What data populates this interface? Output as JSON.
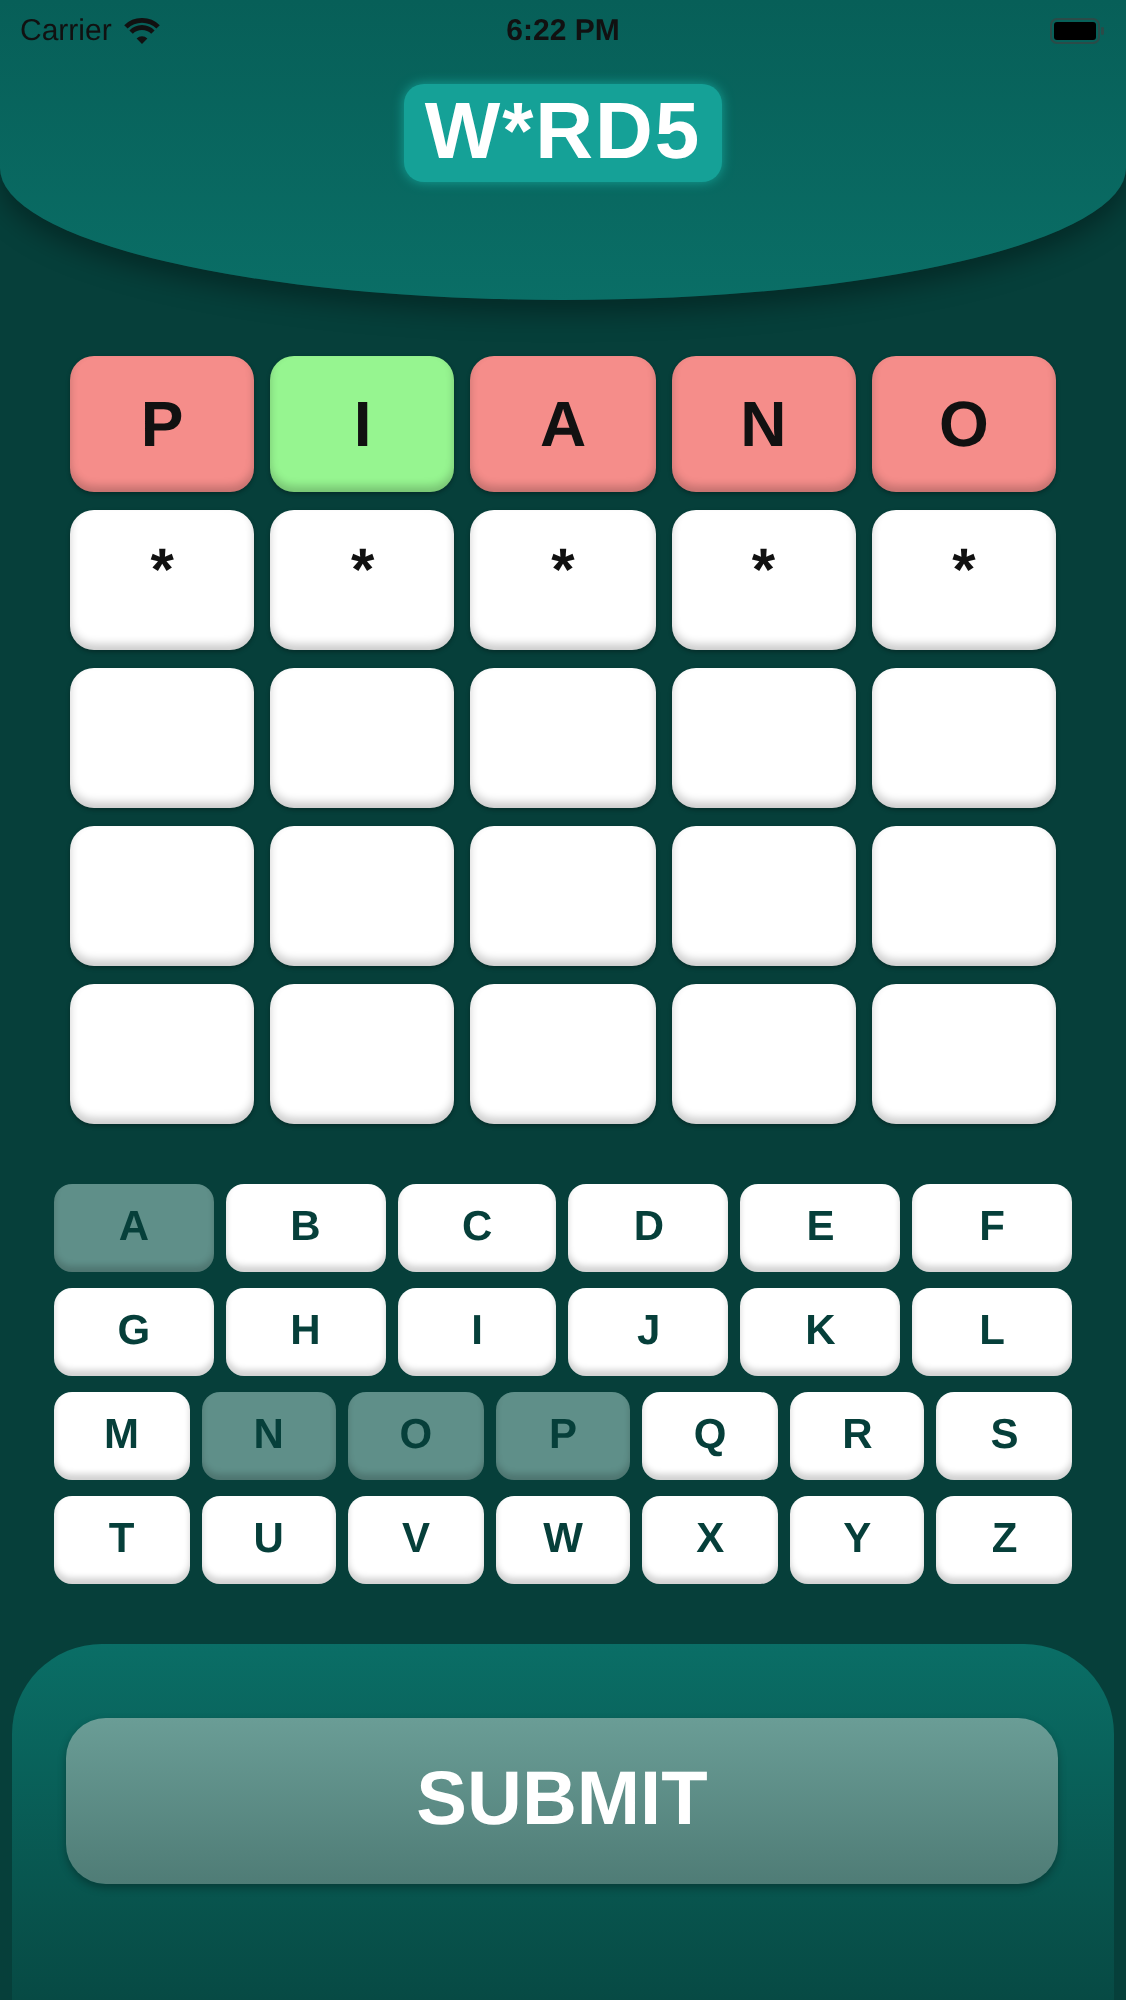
{
  "status_bar": {
    "carrier": "Carrier",
    "time": "6:22 PM"
  },
  "logo": {
    "text": "W*RD5"
  },
  "board": [
    {
      "cells": [
        {
          "kind": "absent",
          "letter": "P"
        },
        {
          "kind": "correct",
          "letter": "I"
        },
        {
          "kind": "absent",
          "letter": "A"
        },
        {
          "kind": "absent",
          "letter": "N"
        },
        {
          "kind": "absent",
          "letter": "O"
        }
      ]
    },
    {
      "cells": [
        {
          "kind": "open",
          "letter": "*"
        },
        {
          "kind": "open",
          "letter": "*"
        },
        {
          "kind": "open",
          "letter": "*"
        },
        {
          "kind": "open",
          "letter": "*"
        },
        {
          "kind": "open",
          "letter": "*"
        }
      ]
    },
    {
      "cells": [
        {
          "kind": "empty"
        },
        {
          "kind": "empty"
        },
        {
          "kind": "empty"
        },
        {
          "kind": "empty"
        },
        {
          "kind": "empty"
        }
      ]
    },
    {
      "cells": [
        {
          "kind": "empty"
        },
        {
          "kind": "empty"
        },
        {
          "kind": "empty"
        },
        {
          "kind": "empty"
        },
        {
          "kind": "empty"
        }
      ]
    },
    {
      "cells": [
        {
          "kind": "empty"
        },
        {
          "kind": "empty"
        },
        {
          "kind": "empty"
        },
        {
          "kind": "empty"
        },
        {
          "kind": "empty"
        }
      ]
    }
  ],
  "keyboard": [
    {
      "keys": [
        {
          "label": "A",
          "used": true
        },
        {
          "label": "B",
          "used": false
        },
        {
          "label": "C",
          "used": false
        },
        {
          "label": "D",
          "used": false
        },
        {
          "label": "E",
          "used": false
        },
        {
          "label": "F",
          "used": false
        }
      ]
    },
    {
      "keys": [
        {
          "label": "G",
          "used": false
        },
        {
          "label": "H",
          "used": false
        },
        {
          "label": "I",
          "used": false
        },
        {
          "label": "J",
          "used": false
        },
        {
          "label": "K",
          "used": false
        },
        {
          "label": "L",
          "used": false
        }
      ]
    },
    {
      "keys": [
        {
          "label": "M",
          "used": false
        },
        {
          "label": "N",
          "used": true
        },
        {
          "label": "O",
          "used": true
        },
        {
          "label": "P",
          "used": true
        },
        {
          "label": "Q",
          "used": false
        },
        {
          "label": "R",
          "used": false
        },
        {
          "label": "S",
          "used": false
        }
      ]
    },
    {
      "keys": [
        {
          "label": "T",
          "used": false
        },
        {
          "label": "U",
          "used": false
        },
        {
          "label": "V",
          "used": false
        },
        {
          "label": "W",
          "used": false
        },
        {
          "label": "X",
          "used": false
        },
        {
          "label": "Y",
          "used": false
        },
        {
          "label": "Z",
          "used": false
        }
      ]
    }
  ],
  "submit_button": {
    "label": "SUBMIT"
  }
}
